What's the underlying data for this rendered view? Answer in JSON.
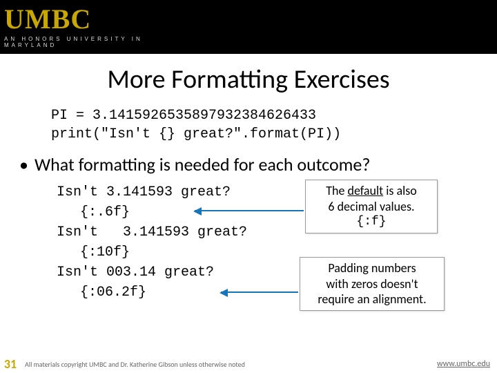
{
  "header": {
    "logo": "UMBC",
    "tagline": "AN HONORS UNIVERSITY IN MARYLAND"
  },
  "title": "More Formatting Exercises",
  "code": {
    "line1": "PI = 3.1415926535897932384626433",
    "line2": "print(\"Isn't {} great?\".format(PI))"
  },
  "bullet": "What formatting is needed for each outcome?",
  "outcomes": {
    "l1": "Isn't 3.141593 great?",
    "l2": "{:.6f}",
    "l3": "Isn't   3.141593 great?",
    "l4": "{:10f}",
    "l5": "Isn't 003.14 great?",
    "l6": "{:06.2f}"
  },
  "callouts": {
    "a_pre": "The ",
    "a_u": "default",
    "a_post": " is also",
    "a_line2": "6 decimal values.",
    "a_mono": "{:f}",
    "b_line1": "Padding numbers",
    "b_line2": "with zeros doesn't",
    "b_line3": "require an alignment."
  },
  "footer": {
    "num": "31",
    "copyright": "All materials copyright UMBC and Dr. Katherine Gibson unless otherwise noted",
    "site": "www.umbc.edu"
  }
}
